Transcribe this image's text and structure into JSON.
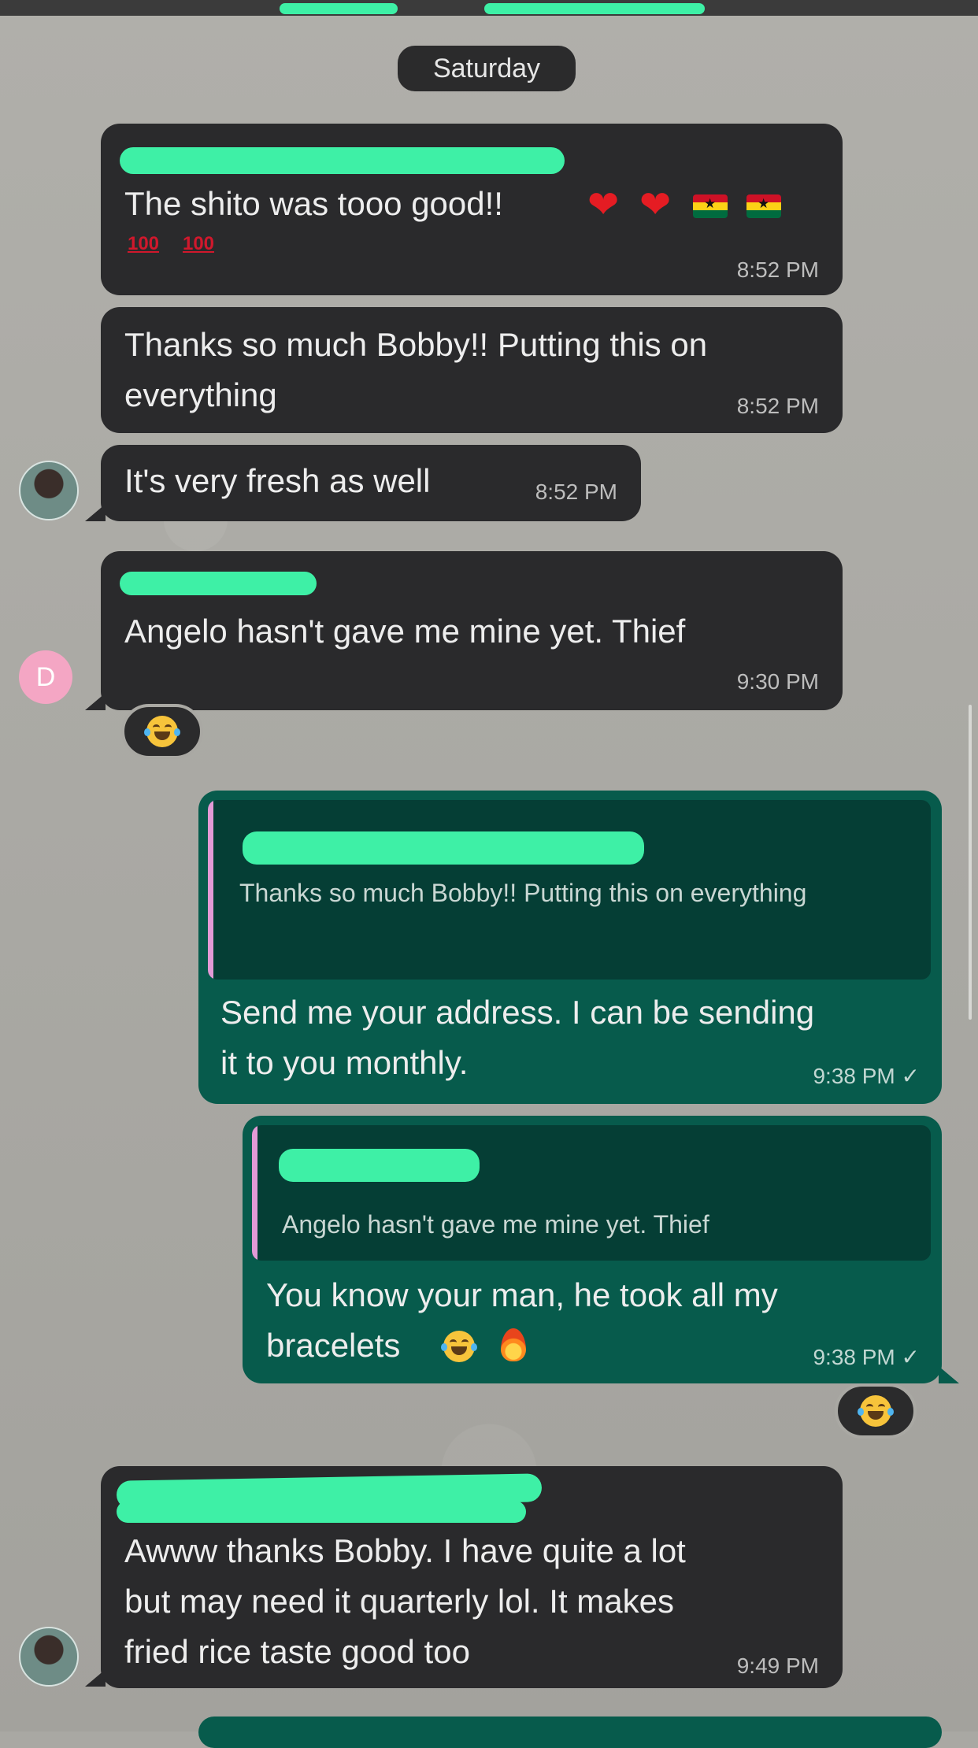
{
  "date_separator": "Saturday",
  "messages": [
    {
      "id": "m1",
      "direction": "incoming",
      "text": "The shito was tooo good!!",
      "time": "8:52 PM"
    },
    {
      "id": "m2",
      "direction": "incoming",
      "text": "Thanks so much Bobby!! Putting this on\neverything",
      "time": "8:52 PM"
    },
    {
      "id": "m3",
      "direction": "incoming",
      "text": "It's very fresh as well",
      "time": "8:52 PM"
    },
    {
      "id": "m4",
      "direction": "incoming",
      "text": "Angelo hasn't gave me mine yet. Thief",
      "time": "9:30 PM",
      "avatar_letter": "D"
    },
    {
      "id": "m5",
      "direction": "outgoing",
      "quote": "Thanks so much Bobby!! Putting this on\neverything",
      "text": "Send me your address. I can be sending\nit to you monthly.",
      "time": "9:38 PM"
    },
    {
      "id": "m6",
      "direction": "outgoing",
      "quote": "Angelo hasn't gave me mine yet. Thief",
      "text": "You know your man, he took all my\nbracelets",
      "time": "9:38 PM"
    },
    {
      "id": "m7",
      "direction": "incoming",
      "text": "Awww thanks Bobby. I have quite a lot\nbut may need it quarterly lol. It makes\nfried rice taste good too",
      "time": "9:49 PM"
    }
  ],
  "icons": {
    "heart": "red-heart-emoji",
    "flag": "ghana-flag-emoji",
    "hundred": "hundred-points-emoji",
    "laugh": "face-with-tears-of-joy-emoji",
    "fire": "fire-emoji",
    "check": "single-check-icon"
  },
  "colors": {
    "incoming_bubble": "#2a2a2c",
    "outgoing_bubble": "#075b4c",
    "quote_accent": "#e39ad6",
    "redaction": "#3ef0a6"
  }
}
